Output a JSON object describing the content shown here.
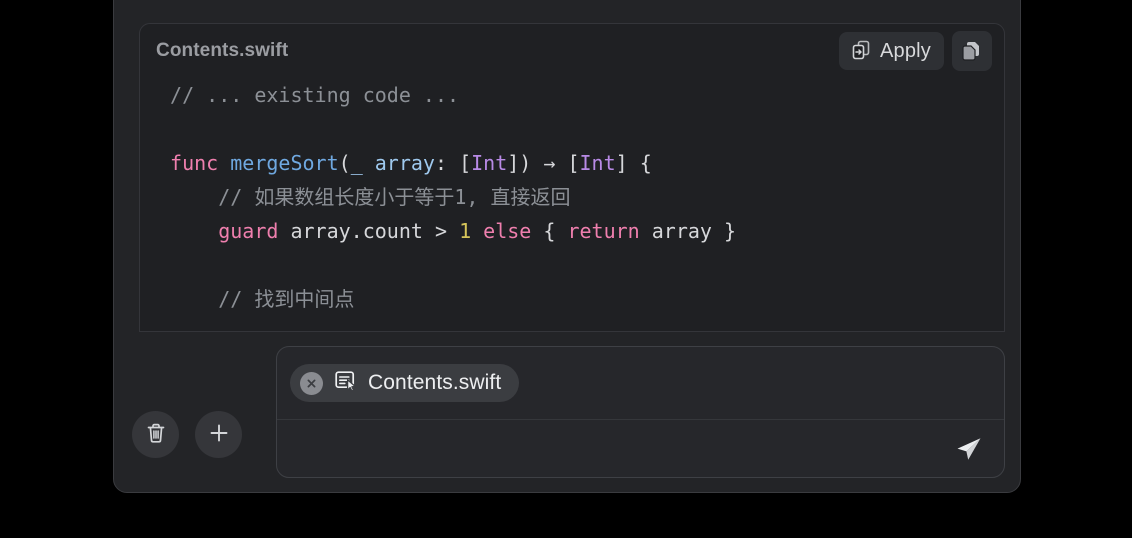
{
  "code_card": {
    "filename": "Contents.swift",
    "apply_label": "Apply",
    "apply_icon": "document-arrow-right-icon",
    "copy_icon": "copy-documents-icon",
    "lines": [
      {
        "id": "line-1",
        "tokens": [
          {
            "text": " // ... existing code ...",
            "type": "cmt"
          }
        ]
      },
      {
        "id": "line-2",
        "tokens": []
      },
      {
        "id": "line-3",
        "tokens": [
          {
            "text": " ",
            "type": "plain"
          },
          {
            "text": "func",
            "type": "kw"
          },
          {
            "text": " ",
            "type": "plain"
          },
          {
            "text": "mergeSort",
            "type": "fn"
          },
          {
            "text": "(",
            "type": "punc"
          },
          {
            "text": "_ array",
            "type": "param"
          },
          {
            "text": ": [",
            "type": "punc"
          },
          {
            "text": "Int",
            "type": "type"
          },
          {
            "text": "]) → [",
            "type": "punc"
          },
          {
            "text": "Int",
            "type": "type"
          },
          {
            "text": "] {",
            "type": "punc"
          }
        ]
      },
      {
        "id": "line-4",
        "tokens": [
          {
            "text": "     // 如果数组长度小于等于1, 直接返回",
            "type": "cmt"
          }
        ]
      },
      {
        "id": "line-5",
        "tokens": [
          {
            "text": "     ",
            "type": "plain"
          },
          {
            "text": "guard",
            "type": "kw"
          },
          {
            "text": " array.count > ",
            "type": "plain"
          },
          {
            "text": "1",
            "type": "num"
          },
          {
            "text": " ",
            "type": "plain"
          },
          {
            "text": "else",
            "type": "kw"
          },
          {
            "text": " { ",
            "type": "plain"
          },
          {
            "text": "return",
            "type": "kw"
          },
          {
            "text": " array }",
            "type": "plain"
          }
        ]
      },
      {
        "id": "line-6",
        "tokens": []
      },
      {
        "id": "line-7",
        "tokens": [
          {
            "text": "     // 找到中间点",
            "type": "cmt"
          }
        ]
      }
    ]
  },
  "scroll_bottom": {
    "icon": "arrow-down-icon"
  },
  "composer": {
    "chip": {
      "label": "Contents.swift",
      "remove_icon": "close-x-icon",
      "file_icon": "document-cursor-icon"
    },
    "input_value": "",
    "input_placeholder": "",
    "send_icon": "paper-plane-icon"
  },
  "bottom_actions": [
    {
      "id": "clear-chat-button",
      "icon": "trash-icon"
    },
    {
      "id": "new-chat-button",
      "icon": "plus-icon"
    }
  ],
  "colors": {
    "page_background": "#000000",
    "panel_background": "#232427",
    "code_background": "#1f2023",
    "composer_background": "#26272b",
    "accent_keyword": "#ef7fae",
    "accent_function": "#6fa8e0",
    "accent_type": "#b88ae6",
    "accent_number": "#d6c55a",
    "comment": "#8c9096"
  }
}
